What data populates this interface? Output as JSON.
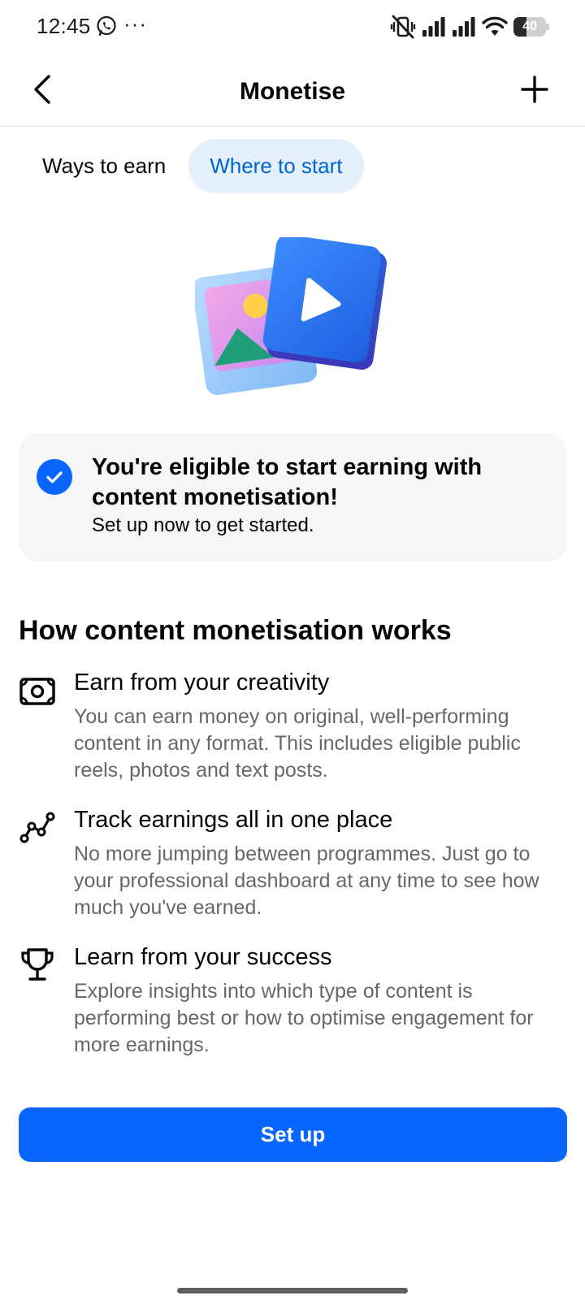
{
  "status_bar": {
    "time": "12:45",
    "overflow": "···",
    "app_icon": "whatsapp-icon",
    "battery_level": "40",
    "icons": [
      "vibrate-off-icon",
      "signal-icon",
      "signal-icon",
      "wifi-icon",
      "battery-icon"
    ]
  },
  "header": {
    "title": "Monetise",
    "back_icon": "back-arrow-icon",
    "add_icon": "plus-icon"
  },
  "tabs": [
    {
      "label": "Ways to earn",
      "active": false
    },
    {
      "label": "Where to start",
      "active": true
    }
  ],
  "eligibility": {
    "title": "You're eligible to start earning with content monetisation!",
    "subtitle": "Set up now to get started.",
    "icon": "check-circle-icon"
  },
  "how_it_works": {
    "title": "How content monetisation works",
    "items": [
      {
        "icon": "money-icon",
        "title": "Earn from your creativity",
        "description": "You can earn money on original, well-performing content in any format. This includes eligible public reels, photos and text posts."
      },
      {
        "icon": "trend-line-icon",
        "title": "Track earnings all in one place",
        "description": "No more jumping between programmes. Just go to your professional dashboard at any time to see how much you've earned."
      },
      {
        "icon": "trophy-icon",
        "title": "Learn from your success",
        "description": "Explore insights into which type of content is performing best or how to optimise engagement for more earnings."
      }
    ]
  },
  "primary_action": {
    "label": "Set up"
  },
  "colors": {
    "accent": "#0866ff",
    "tab_active_bg": "#e5f0fd",
    "tab_active_text": "#0064d1",
    "secondary_text": "#65676b",
    "card_bg": "#f5f6f8"
  }
}
